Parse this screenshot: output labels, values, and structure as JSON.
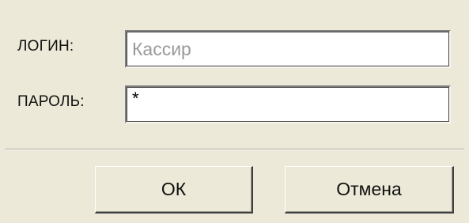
{
  "login": {
    "label": "ЛОГИН:",
    "value": "Кассир"
  },
  "password": {
    "label": "ПАРОЛЬ:",
    "value": "*"
  },
  "buttons": {
    "ok": "ОК",
    "cancel": "Отмена"
  },
  "colors": {
    "dialog_background": "#ece9d8",
    "field_background": "#ffffff",
    "readonly_text": "#9a9a9a"
  }
}
